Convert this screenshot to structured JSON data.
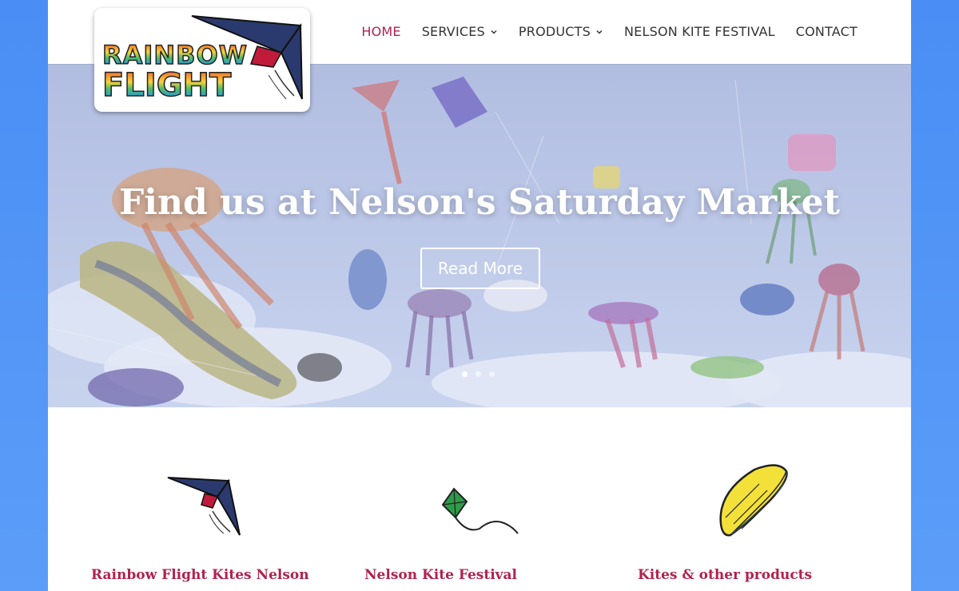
{
  "brand": {
    "logo_line1": "RAINBOW",
    "logo_line2": "FLIGHT",
    "accent_color": "#b0224f"
  },
  "nav": {
    "items": [
      {
        "label": "HOME",
        "active": true,
        "has_dropdown": false
      },
      {
        "label": "SERVICES",
        "active": false,
        "has_dropdown": true
      },
      {
        "label": "PRODUCTS",
        "active": false,
        "has_dropdown": true
      },
      {
        "label": "NELSON KITE FESTIVAL",
        "active": false,
        "has_dropdown": false
      },
      {
        "label": "CONTACT",
        "active": false,
        "has_dropdown": false
      }
    ]
  },
  "hero": {
    "title": "Find us at Nelson's Saturday Market",
    "button_label": "Read More",
    "slide_count": 3,
    "active_slide": 1
  },
  "features": [
    {
      "title": "Rainbow Flight Kites Nelson",
      "icon": "delta-kite-icon"
    },
    {
      "title": "Nelson Kite Festival",
      "icon": "diamond-kite-icon"
    },
    {
      "title": "Kites & other products",
      "icon": "power-kite-icon"
    }
  ]
}
